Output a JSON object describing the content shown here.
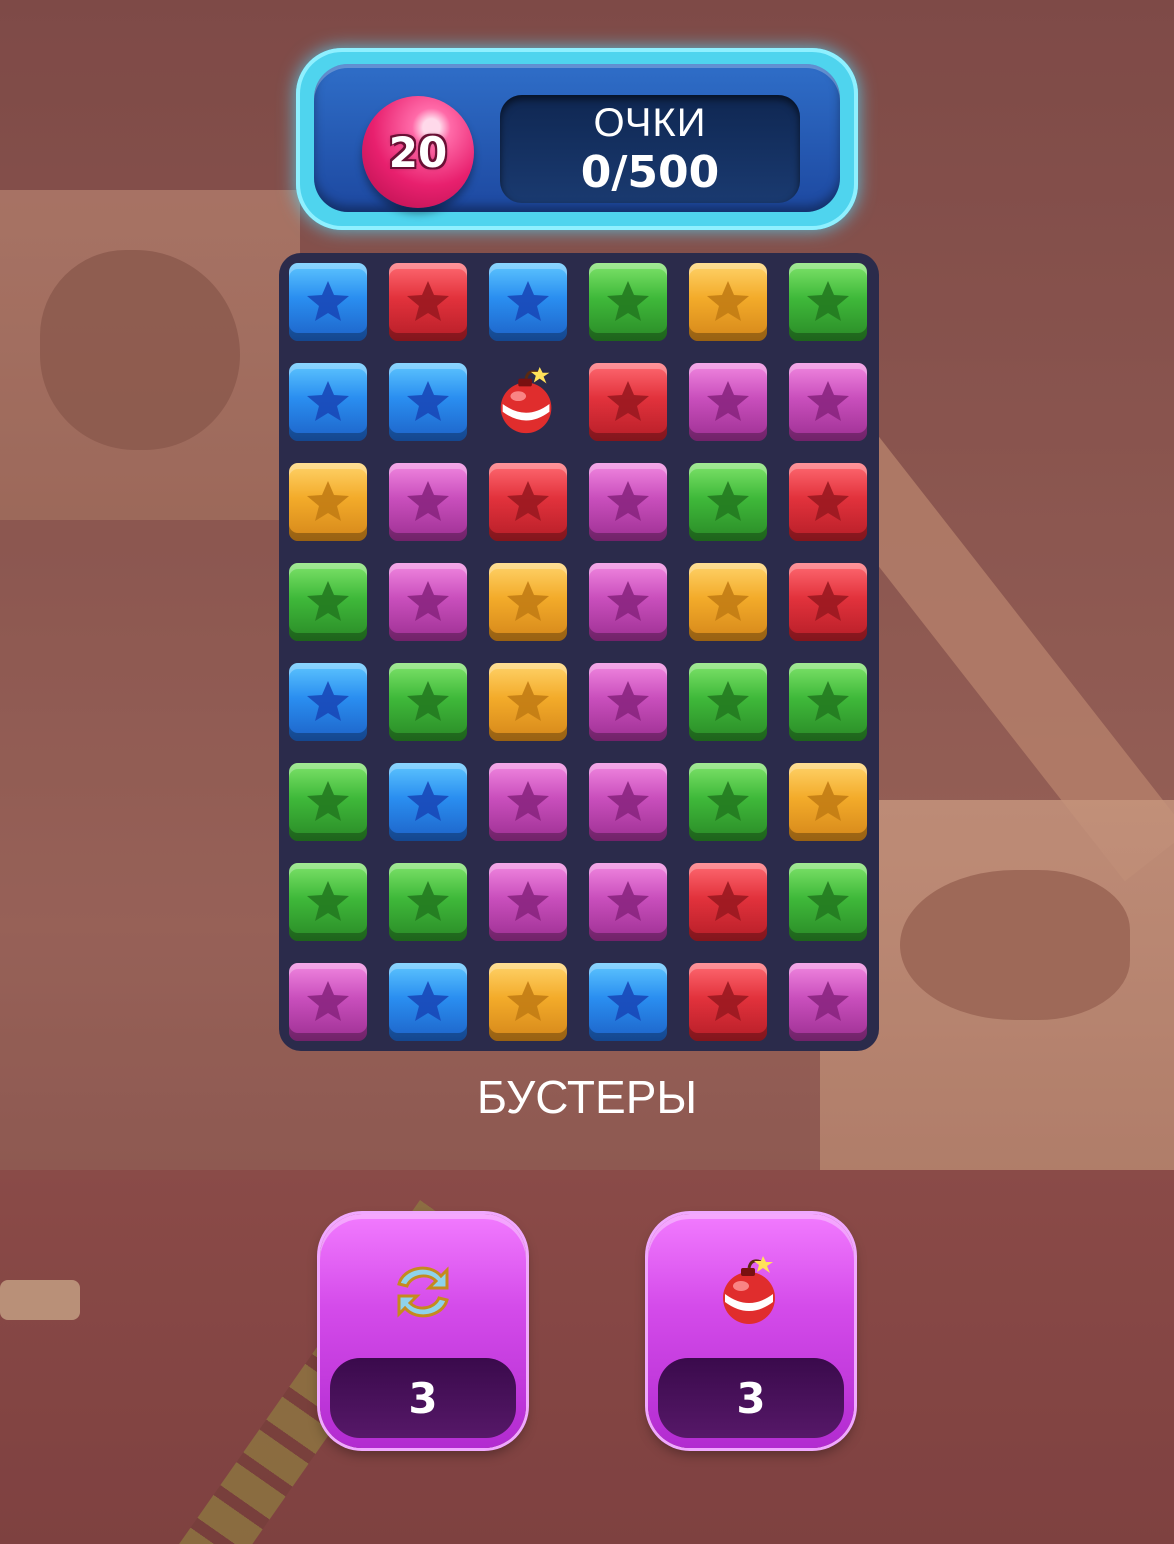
{
  "hud": {
    "moves_left": "20",
    "score_label": "ОЧКИ",
    "score_value": "0/500"
  },
  "board": {
    "columns": 6,
    "rows": 8,
    "tiles": [
      [
        "blue",
        "red",
        "blue",
        "green",
        "orange",
        "green"
      ],
      [
        "blue",
        "blue",
        "bomb",
        "red",
        "purple",
        "purple"
      ],
      [
        "orange",
        "purple",
        "red",
        "purple",
        "green",
        "red"
      ],
      [
        "green",
        "purple",
        "orange",
        "purple",
        "orange",
        "red"
      ],
      [
        "blue",
        "green",
        "orange",
        "purple",
        "green",
        "green"
      ],
      [
        "green",
        "blue",
        "purple",
        "purple",
        "green",
        "orange"
      ],
      [
        "green",
        "green",
        "purple",
        "purple",
        "red",
        "green"
      ],
      [
        "purple",
        "blue",
        "orange",
        "blue",
        "red",
        "purple"
      ]
    ]
  },
  "boosters": {
    "title": "БУСТЕРЫ",
    "items": [
      {
        "icon": "shuffle-arrows-icon",
        "count": "3"
      },
      {
        "icon": "bomb-icon",
        "count": "3"
      }
    ]
  },
  "colors": {
    "blue": "#2a8ef0",
    "red": "#e2323c",
    "green": "#3fb93a",
    "orange": "#f3ab2a",
    "purple": "#c94fbc",
    "board_bg": "#2b2b4b",
    "panel_glow": "#4fd4ee"
  }
}
